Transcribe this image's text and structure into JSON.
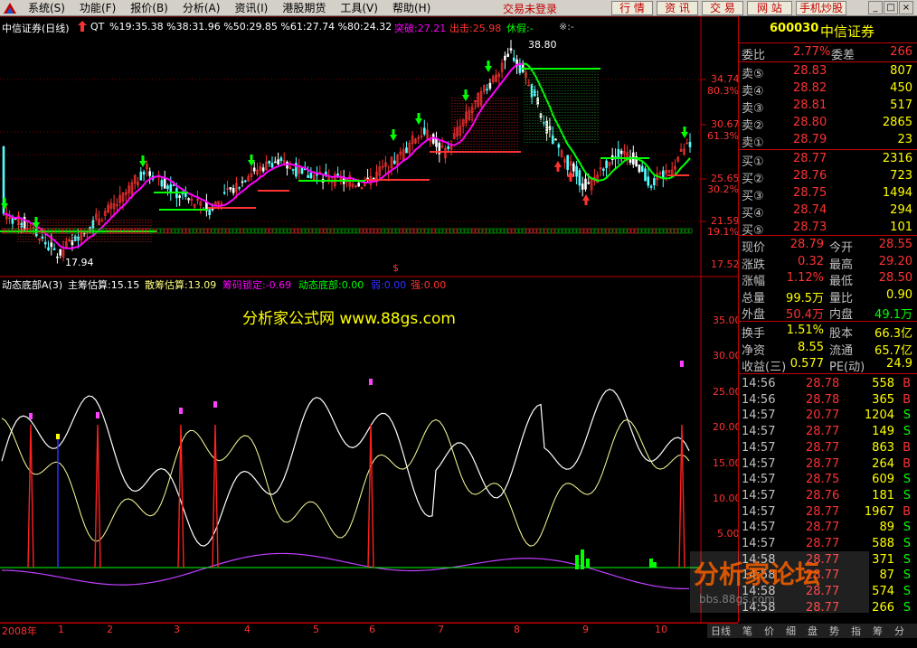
{
  "menubar": {
    "items": [
      "系统(S)",
      "功能(F)",
      "报价(B)",
      "分析(A)",
      "资讯(I)",
      "港股期货",
      "工具(V)",
      "帮助(H)"
    ],
    "trade_status": "交易未登录",
    "buttons": [
      "行 情",
      "资 讯",
      "交 易",
      "网 站",
      "手机炒股"
    ],
    "win_controls": [
      "_",
      "□",
      "×"
    ]
  },
  "chart": {
    "header": {
      "name": "中信证券(日线)",
      "qt": "QT",
      "metrics": "%19:35.38  %38:31.96  %50:29.85  %61:27.74  %80:24.32",
      "break_label": "突破:27.21",
      "exit_label": "出击:25.98",
      "rest_label": "休假:-",
      "extra": "※:-"
    },
    "price_axis": [
      "34.74",
      "80.3%",
      "30.67",
      "61.3%",
      "25.65",
      "30.2%",
      "21.59",
      "19.1%",
      "17.52"
    ],
    "annotations": {
      "high": "38.80",
      "low": "17.94",
      "marker": "$"
    },
    "indicator_header": {
      "name": "动态底部A(3)",
      "main_chip": "主筹估算:15.15",
      "retail_chip": "散筹估算:13.09",
      "lock": "筹码锁定:-0.69",
      "dyn_bottom": "动态底部:0.00",
      "weak": "弱:0.00",
      "strong": "强:0.00"
    },
    "indicator_axis": [
      "35.00",
      "30.00",
      "25.00",
      "20.00",
      "15.00",
      "10.00",
      "5.00"
    ],
    "watermark": "分析家公式网 www.88gs.com",
    "date_axis": [
      "2008年",
      "1",
      "2",
      "3",
      "4",
      "5",
      "6",
      "7",
      "8",
      "9",
      "10"
    ],
    "colors": {
      "up": "#ff3232",
      "down": "#54ffff",
      "ma": "#ff00ff",
      "arrow_down": "#00ff00",
      "arrow_up": "#ff3232"
    }
  },
  "panel": {
    "code": "600030",
    "name": "中信证券",
    "wb_label": "委比",
    "wb_value": "2.77%",
    "wc_label": "委差",
    "wc_value": "266",
    "asks": [
      {
        "label": "卖⑤",
        "price": "28.83",
        "vol": "807"
      },
      {
        "label": "卖④",
        "price": "28.82",
        "vol": "450"
      },
      {
        "label": "卖③",
        "price": "28.81",
        "vol": "517"
      },
      {
        "label": "卖②",
        "price": "28.80",
        "vol": "2865"
      },
      {
        "label": "卖①",
        "price": "28.79",
        "vol": "23"
      }
    ],
    "bids": [
      {
        "label": "买①",
        "price": "28.77",
        "vol": "2316"
      },
      {
        "label": "买②",
        "price": "28.76",
        "vol": "723"
      },
      {
        "label": "买③",
        "price": "28.75",
        "vol": "1494"
      },
      {
        "label": "买④",
        "price": "28.74",
        "vol": "294"
      },
      {
        "label": "买⑤",
        "price": "28.73",
        "vol": "101"
      }
    ],
    "stats": [
      {
        "l1": "现价",
        "v1": "28.79",
        "l2": "今开",
        "v2": "28.55"
      },
      {
        "l1": "涨跌",
        "v1": "0.32",
        "l2": "最高",
        "v2": "29.20"
      },
      {
        "l1": "涨幅",
        "v1": "1.12%",
        "l2": "最低",
        "v2": "28.50"
      },
      {
        "l1": "总量",
        "v1": "99.5万",
        "l2": "量比",
        "v2": "0.90"
      },
      {
        "l1": "外盘",
        "v1": "50.4万",
        "l2": "内盘",
        "v2": "49.1万"
      }
    ],
    "fund": [
      {
        "l1": "换手",
        "v1": "1.51%",
        "l2": "股本",
        "v2": "66.3亿"
      },
      {
        "l1": "净资",
        "v1": "8.55",
        "l2": "流通",
        "v2": "65.7亿"
      },
      {
        "l1": "收益(三)",
        "v1": "0.577",
        "l2": "PE(动)",
        "v2": "24.9"
      }
    ],
    "ticks": [
      {
        "t": "14:56",
        "p": "28.78",
        "v": "558",
        "s": "B"
      },
      {
        "t": "14:56",
        "p": "28.78",
        "v": "365",
        "s": "B"
      },
      {
        "t": "14:57",
        "p": "20.77",
        "v": "1204",
        "s": "S"
      },
      {
        "t": "14:57",
        "p": "28.77",
        "v": "149",
        "s": "S"
      },
      {
        "t": "14:57",
        "p": "28.77",
        "v": "863",
        "s": "B"
      },
      {
        "t": "14:57",
        "p": "28.77",
        "v": "264",
        "s": "B"
      },
      {
        "t": "14:57",
        "p": "28.75",
        "v": "609",
        "s": "S"
      },
      {
        "t": "14:57",
        "p": "28.76",
        "v": "181",
        "s": "S"
      },
      {
        "t": "14:57",
        "p": "28.77",
        "v": "1967",
        "s": "B"
      },
      {
        "t": "14:57",
        "p": "28.77",
        "v": "89",
        "s": "S"
      },
      {
        "t": "14:57",
        "p": "28.77",
        "v": "588",
        "s": "S"
      },
      {
        "t": "14:58",
        "p": "28.77",
        "v": "371",
        "s": "S"
      },
      {
        "t": "14:58",
        "p": "28.77",
        "v": "87",
        "s": "S"
      },
      {
        "t": "14:58",
        "p": "28.77",
        "v": "574",
        "s": "S"
      },
      {
        "t": "14:58",
        "p": "28.77",
        "v": "266",
        "s": "S"
      }
    ],
    "forum_watermark": "分析家论坛",
    "forum_url": "bbs.88gs.com"
  },
  "bottombar": {
    "tabs": [
      "日线",
      "笔",
      "价",
      "细",
      "盘",
      "势",
      "指",
      "筹",
      "分"
    ]
  }
}
